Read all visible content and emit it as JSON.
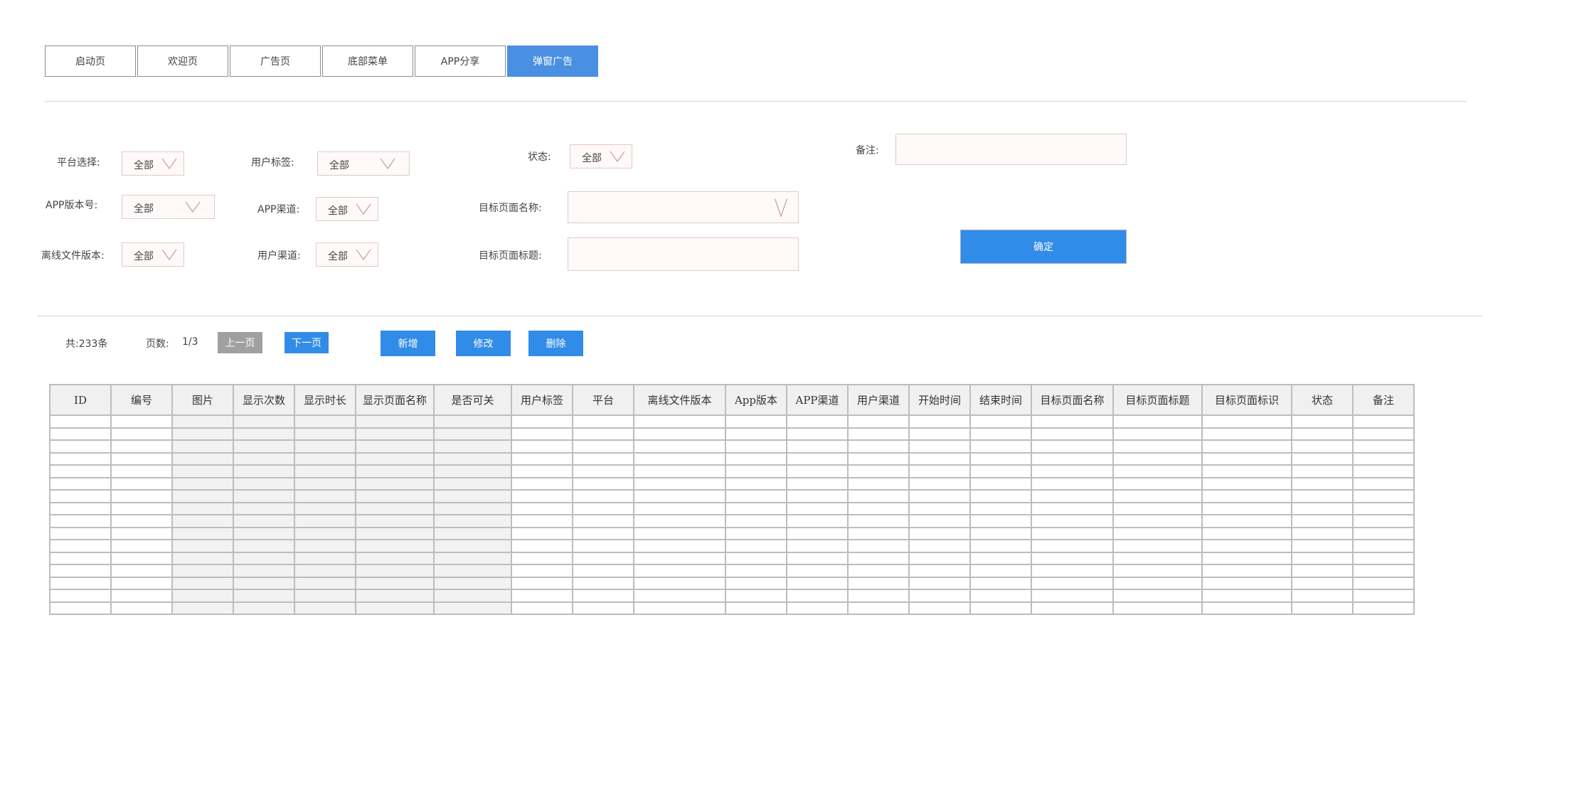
{
  "tabs": [
    {
      "label": "启动页",
      "active": false
    },
    {
      "label": "欢迎页",
      "active": false
    },
    {
      "label": "广告页",
      "active": false
    },
    {
      "label": "底部菜单",
      "active": false
    },
    {
      "label": "APP分享",
      "active": false
    },
    {
      "label": "弹窗广告",
      "active": true
    }
  ],
  "filters": {
    "platform": {
      "label": "平台选择:",
      "value": "全部"
    },
    "user_tag": {
      "label": "用户标签:",
      "value": "全部"
    },
    "status": {
      "label": "状态:",
      "value": "全部"
    },
    "remark": {
      "label": "备注:",
      "value": ""
    },
    "app_version": {
      "label": "APP版本号:",
      "value": "全部"
    },
    "app_channel": {
      "label": "APP渠道:",
      "value": "全部"
    },
    "target_page_name": {
      "label": "目标页面名称:",
      "value": ""
    },
    "offline_version": {
      "label": "离线文件版本:",
      "value": "全部"
    },
    "user_channel": {
      "label": "用户渠道:",
      "value": "全部"
    },
    "target_page_title": {
      "label": "目标页面标题:",
      "value": ""
    },
    "confirm_label": "确定"
  },
  "pager": {
    "total": "共:233条",
    "pages_label": "页数:",
    "pages_value": "1/3",
    "prev_label": "上一页",
    "next_label": "下一页"
  },
  "actions": {
    "add_label": "新增",
    "edit_label": "修改",
    "delete_label": "删除"
  },
  "table": {
    "columns": [
      "ID",
      "编号",
      "图片",
      "显示次数",
      "显示时长",
      "显示页面名称",
      "是否可关",
      "用户标签",
      "平台",
      "离线文件版本",
      "App版本",
      "APP渠道",
      "用户渠道",
      "开始时间",
      "结束时间",
      "目标页面名称",
      "目标页面标题",
      "目标页面标识",
      "状态",
      "备注"
    ],
    "row_count": 16
  },
  "colors": {
    "accent": "#318ce7",
    "active_tab": "#4a90e2",
    "disabled_button": "#a0a0a0"
  }
}
